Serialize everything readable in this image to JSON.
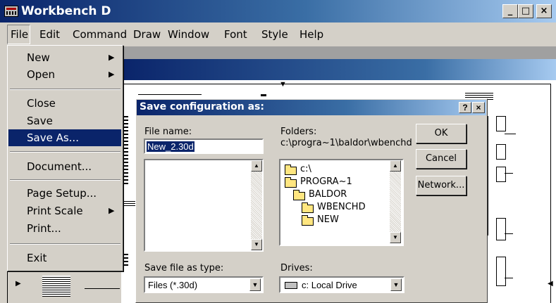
{
  "window": {
    "title": "Workbench D"
  },
  "caption_buttons": {
    "minimize": "_",
    "maximize": "□",
    "close": "×"
  },
  "menubar": [
    "File",
    "Edit",
    "Command",
    "Draw",
    "Window",
    "Font",
    "Style",
    "Help"
  ],
  "file_menu": {
    "new": "New",
    "open": "Open",
    "close": "Close",
    "save": "Save",
    "save_as": "Save As...",
    "document": "Document...",
    "page_setup": "Page Setup...",
    "print_scale": "Print Scale",
    "print": "Print...",
    "exit": "Exit",
    "submenu_arrow": "▶"
  },
  "dialog": {
    "title": "Save configuration as:",
    "help_btn": "?",
    "close_btn": "×",
    "file_name_label": "File name:",
    "file_name_value": "New_2.30d",
    "folders_label": "Folders:",
    "folders_path": "c:\\progra~1\\baldor\\wbenchd",
    "folder_tree": [
      "c:\\",
      "PROGRA~1",
      "BALDOR",
      "WBENCHD",
      "NEW"
    ],
    "ok": "OK",
    "cancel": "Cancel",
    "network": "Network...",
    "save_type_label": "Save file as type:",
    "save_type_value": "Files (*.30d)",
    "drives_label": "Drives:",
    "drives_value": "c: Local Drive"
  },
  "icons": {
    "scroll_up": "▲",
    "scroll_down": "▼",
    "combo": "▼",
    "marker": "▼"
  }
}
